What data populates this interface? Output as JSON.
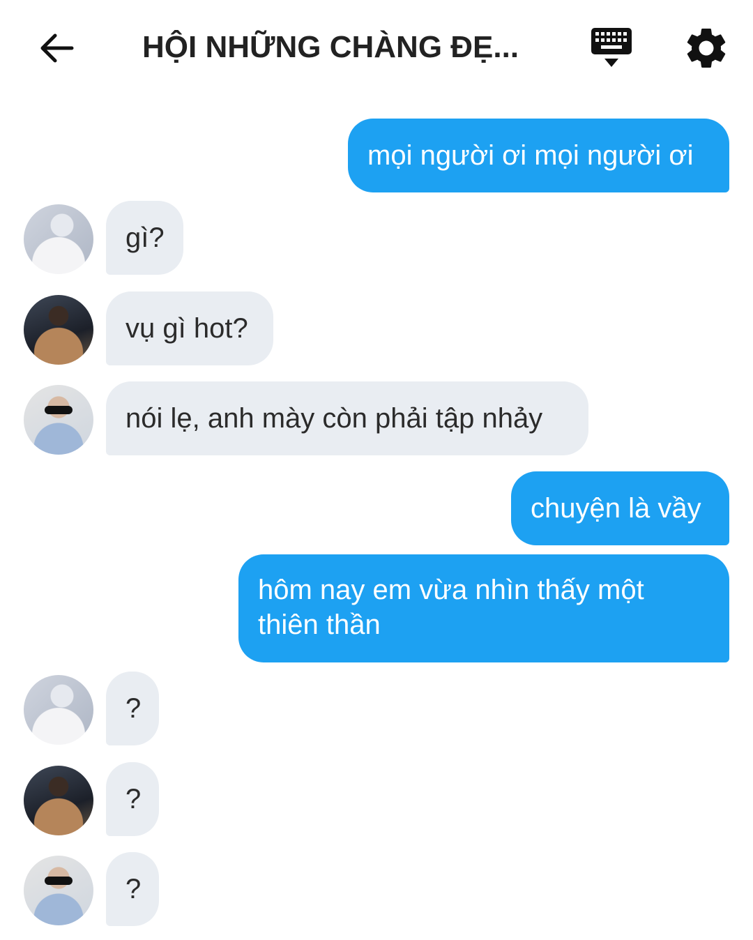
{
  "header": {
    "title": "HỘI NHỮNG CHÀNG ĐẸ...",
    "back_icon": "arrow-left-icon",
    "keyboard_icon": "keyboard-icon",
    "settings_icon": "gear-icon"
  },
  "colors": {
    "outgoing_bubble": "#1da1f2",
    "incoming_bubble": "#e9edf2"
  },
  "messages": [
    {
      "direction": "out",
      "text": "mọi người ơi mọi người ơi"
    },
    {
      "direction": "in",
      "text": "gì?"
    },
    {
      "direction": "in",
      "text": "vụ gì hot?"
    },
    {
      "direction": "in",
      "text": "nói lẹ, anh mày còn phải tập nhảy"
    },
    {
      "direction": "out",
      "text": "chuyện là vầy"
    },
    {
      "direction": "out",
      "text": "hôm nay em vừa nhìn thấy một thiên thần"
    },
    {
      "direction": "in",
      "text": "?"
    },
    {
      "direction": "in",
      "text": "?"
    },
    {
      "direction": "in",
      "text": "?"
    }
  ]
}
